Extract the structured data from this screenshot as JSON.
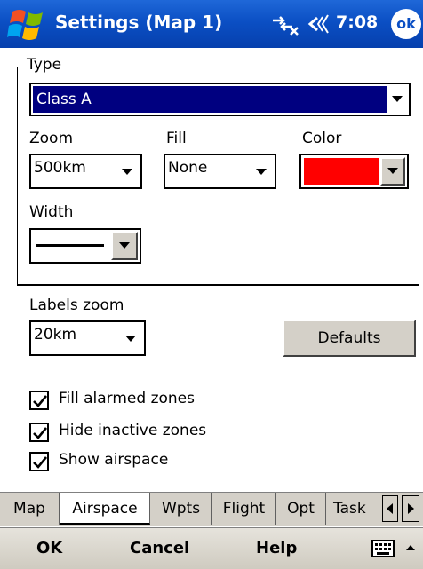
{
  "titlebar": {
    "title": "Settings (Map 1)",
    "time": "7:08",
    "ok_label": "ok",
    "icons": [
      "windows-start-icon",
      "connectivity-icon",
      "volume-icon"
    ]
  },
  "type_group": {
    "legend": "Type",
    "value": "Class A",
    "zoom_label": "Zoom",
    "zoom_value": "500km",
    "fill_label": "Fill",
    "fill_value": "None",
    "color_label": "Color",
    "color_value": "#ff0000",
    "width_label": "Width"
  },
  "labels_zoom": {
    "label": "Labels zoom",
    "value": "20km"
  },
  "defaults_label": "Defaults",
  "checkboxes": [
    {
      "label": "Fill alarmed zones",
      "checked": true
    },
    {
      "label": "Hide inactive zones",
      "checked": true
    },
    {
      "label": "Show airspace",
      "checked": true
    }
  ],
  "tabs": [
    "Map",
    "Airspace",
    "Wpts",
    "Flight",
    "Opt",
    "Task"
  ],
  "active_tab": "Airspace",
  "softkeys": {
    "ok": "OK",
    "cancel": "Cancel",
    "help": "Help"
  }
}
